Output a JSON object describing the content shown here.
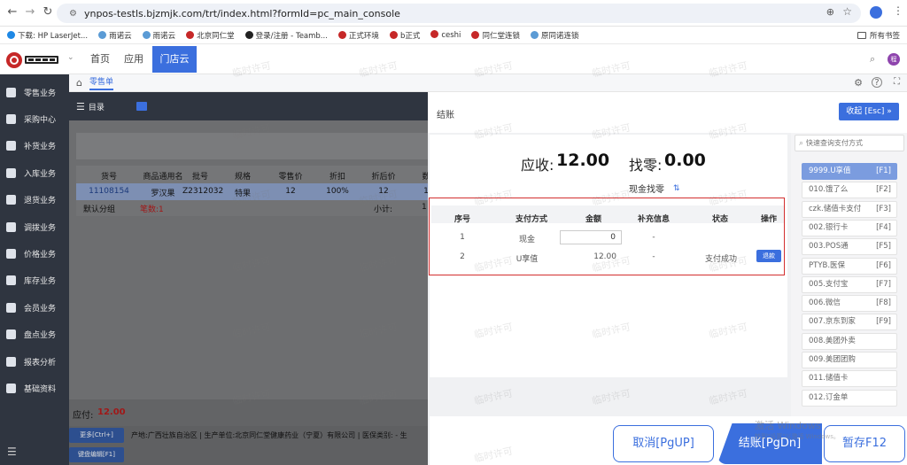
{
  "browser": {
    "url": "ynpos-testls.bjzmjk.com/trt/index.html?formId=pc_main_console",
    "avatar_letter": "",
    "bookmarks": [
      {
        "label": "下载: HP LaserJet...",
        "color": "#1e88e5"
      },
      {
        "label": "雨诺云",
        "color": "#5b9bd5"
      },
      {
        "label": "雨诺云",
        "color": "#5b9bd5"
      },
      {
        "label": "北京同仁堂",
        "color": "#c62828"
      },
      {
        "label": "登录/注册 - Teamb...",
        "color": "#222222"
      },
      {
        "label": "正式环境",
        "color": "#c62828"
      },
      {
        "label": "b正式",
        "color": "#c62828"
      },
      {
        "label": "ceshi",
        "color": "#c62828"
      },
      {
        "label": "同仁堂连锁",
        "color": "#c62828"
      },
      {
        "label": "原同诺连锁",
        "color": "#5b9bd5"
      }
    ],
    "all_bookmarks": "所有书签"
  },
  "app": {
    "nav": [
      "首页",
      "应用",
      "门店云"
    ],
    "active_nav": "门店云",
    "tab_label": "零售单",
    "user_initial": "程"
  },
  "sidebar": [
    {
      "label": "零售业务",
      "icon": "retail-icon"
    },
    {
      "label": "采购中心",
      "icon": "purchase-icon"
    },
    {
      "label": "补货业务",
      "icon": "replenish-icon"
    },
    {
      "label": "入库业务",
      "icon": "inbound-icon"
    },
    {
      "label": "退货业务",
      "icon": "return-icon"
    },
    {
      "label": "调拨业务",
      "icon": "transfer-icon"
    },
    {
      "label": "价格业务",
      "icon": "price-icon"
    },
    {
      "label": "库存业务",
      "icon": "inventory-icon"
    },
    {
      "label": "会员业务",
      "icon": "member-icon"
    },
    {
      "label": "盘点业务",
      "icon": "stocktake-icon"
    },
    {
      "label": "报表分析",
      "icon": "report-icon"
    },
    {
      "label": "基础资料",
      "icon": "basic-data-icon"
    }
  ],
  "list": {
    "menu_label": "目录",
    "headers": [
      "货号",
      "商品通用名",
      "批号",
      "规格",
      "零售价",
      "折扣",
      "折后价",
      "数"
    ],
    "row": [
      "11108154",
      "罗汉果",
      "Z2312032",
      "特果",
      "12",
      "100%",
      "12",
      "1"
    ],
    "group_label": "默认分组",
    "count_label": "笔数:1",
    "subtotal_label": "小计:",
    "subtotal_value": "1",
    "due_label": "应付:",
    "due_value": "12.00",
    "btn1": "更多[Ctrl+]",
    "btn2": "键盘编辑[F1]",
    "footer_text": "产地:广西壮族自治区 | 生产单位:北京同仁堂健康药业（宁夏）有限公司 | 医保类别: - 生"
  },
  "checkout": {
    "title": "结账",
    "collapse_btn": "收起 [Esc] »",
    "receivable_label": "应收:",
    "receivable_value": "12.00",
    "change_label": "找零:",
    "change_value": "0.00",
    "cash_change": "现金找零",
    "table_headers": [
      "序号",
      "支付方式",
      "金额",
      "补充信息",
      "状态",
      "操作"
    ],
    "rows": [
      {
        "no": "1",
        "method": "现金",
        "amount": "0",
        "info": "-",
        "status": "",
        "action": ""
      },
      {
        "no": "2",
        "method": "U享值",
        "amount": "12.00",
        "info": "-",
        "status": "支付成功",
        "action": "退款"
      }
    ],
    "search_placeholder": "快速查询支付方式",
    "methods": [
      {
        "label": "9999.U享值",
        "key": "[F1]"
      },
      {
        "label": "010.饿了么",
        "key": "[F2]"
      },
      {
        "label": "czk.储值卡支付",
        "key": "[F3]"
      },
      {
        "label": "002.银行卡",
        "key": "[F4]"
      },
      {
        "label": "003.POS通",
        "key": "[F5]"
      },
      {
        "label": "PTYB.医保",
        "key": "[F6]"
      },
      {
        "label": "005.支付宝",
        "key": "[F7]"
      },
      {
        "label": "006.微信",
        "key": "[F8]"
      },
      {
        "label": "007.京东到家",
        "key": "[F9]"
      },
      {
        "label": "008.美团外卖",
        "key": ""
      },
      {
        "label": "009.美团团购",
        "key": ""
      },
      {
        "label": "011.储值卡",
        "key": ""
      },
      {
        "label": "012.订金单",
        "key": ""
      }
    ],
    "cancel_btn": "取消[PgUP]",
    "pay_btn": "结账[PgDn]",
    "hold_btn": "暂存F12",
    "activate_title": "激活 Windows",
    "activate_sub": "转到\"设置\"以激活 Windows。"
  },
  "watermark": "临时许可",
  "colors": {
    "accent": "#3b6fde",
    "sidebar": "#2f3540",
    "highlight": "#c62828",
    "red_box": "#d32f2f"
  }
}
